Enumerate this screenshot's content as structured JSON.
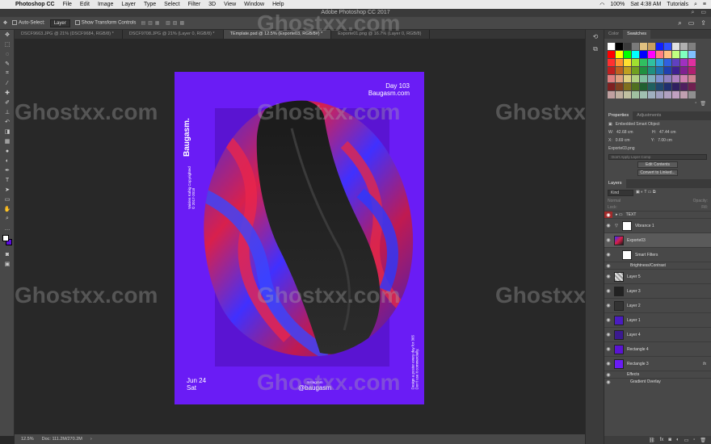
{
  "menubar": {
    "app_name": "Photoshop CC",
    "items": [
      "File",
      "Edit",
      "Image",
      "Layer",
      "Type",
      "Select",
      "Filter",
      "3D",
      "View",
      "Window",
      "Help"
    ],
    "clock": "Sat 4:38 AM",
    "user": "Tutorials",
    "battery": "100%"
  },
  "titlebar": {
    "title": "Adobe Photoshop CC 2017"
  },
  "options": {
    "auto_select_label": "Auto-Select:",
    "auto_select_value": "Layer",
    "transform_label": "Show Transform Controls"
  },
  "tabs": [
    {
      "label": "DSCF9663.JPG @ 21% (DSCF9684, RGB/8) *"
    },
    {
      "label": "DSCF9708.JPG @ 21% (Layer 0, RGB/8) *"
    },
    {
      "label": "TEmplate.psd @ 12.5% (Exporte03, RGB/8#) *"
    },
    {
      "label": "Exporte01.png @ 16.7% (Layer 0, RGB/8)"
    }
  ],
  "poster": {
    "day_line": "Day 103",
    "site_line": "Baugasm.com",
    "vertical_title": "Baugasm.",
    "vertical_copy_1": "Vaislen Kahig Copyrighted",
    "vertical_copy_2": "© 2017-2018",
    "date_line_1": "Jun 24",
    "date_line_2": "Sat",
    "insta_label": "Instagram",
    "insta_handle": "@baugasm",
    "vertical_right_1": "Design a poster every day for 365",
    "vertical_right_2": "Don't use it commercially.",
    "colors": {
      "background": "#6a1cf5",
      "accent_red": "#e02046",
      "accent_blue": "#3a2cff"
    }
  },
  "watermark": "Ghostxx.com",
  "status": {
    "zoom": "12.5%",
    "doc": "Doc: 111.2M/270.2M"
  },
  "panels": {
    "color_tab": "Color",
    "swatches_tab": "Swatches",
    "swatch_colors": [
      "#ffffff",
      "#000000",
      "#3a3a3a",
      "#7a7a7a",
      "#e0c080",
      "#c8a060",
      "#1020ff",
      "#3050ff",
      "#e0e0e0",
      "#b0b0b0",
      "#808080",
      "#ff0000",
      "#ffff00",
      "#00ff00",
      "#00ffff",
      "#0000ff",
      "#ff00ff",
      "#ff8080",
      "#ffc080",
      "#c0ff80",
      "#80ffc0",
      "#80c0ff",
      "#ff3030",
      "#ff9030",
      "#ffe030",
      "#a0e030",
      "#30c060",
      "#30c0a0",
      "#30a0e0",
      "#3060e0",
      "#6040c0",
      "#a030c0",
      "#e030a0",
      "#c02020",
      "#c06020",
      "#c0a020",
      "#70a020",
      "#209040",
      "#209080",
      "#2070b0",
      "#2040b0",
      "#402090",
      "#802090",
      "#b02070",
      "#e08080",
      "#e0a080",
      "#e0d080",
      "#b0d080",
      "#80c0a0",
      "#80b0c0",
      "#8090d0",
      "#9080c0",
      "#b080c0",
      "#d080b0",
      "#d08090",
      "#802020",
      "#804020",
      "#807020",
      "#507020",
      "#206030",
      "#206060",
      "#204870",
      "#203070",
      "#302060",
      "#502060",
      "#702050",
      "#c0a0a0",
      "#c0b0a0",
      "#c0c0a0",
      "#a0c0a0",
      "#a0c0b0",
      "#a0b0c0",
      "#a0a0c0",
      "#b0a0c0",
      "#c0a0c0",
      "#c0a0b0",
      "#909090"
    ],
    "properties_tab": "Properties",
    "adjustments_tab": "Adjustments",
    "smart_object": "Embedded Smart Object",
    "w_label": "W:",
    "w_value": "42.68 cm",
    "h_label": "H:",
    "h_value": "47.44 cm",
    "x_label": "X:",
    "x_value": "0.69 cm",
    "y_label": "Y:",
    "y_value": "7.00 cm",
    "filename": "Exporte03.png",
    "layer_comp": "Don't Apply Layer Comp",
    "edit_contents": "Edit Contents",
    "convert_linked": "Convert to Linked...",
    "layers_tab": "Layers",
    "kind_label": "Kind",
    "normal_label": "Normal",
    "opacity_label": "Opacity:",
    "lock_label": "Lock:",
    "fill_label": "Fill:",
    "layers": [
      {
        "name": "TEXT",
        "type": "folder"
      },
      {
        "name": "Vibrance 1",
        "type": "adjust"
      },
      {
        "name": "Exporte03",
        "type": "smart"
      },
      {
        "name": "Smart Filters",
        "type": "filter"
      },
      {
        "name": "Brightness/Contrast",
        "type": "filterline"
      },
      {
        "name": "Layer 5",
        "type": "pixel"
      },
      {
        "name": "Layer 3",
        "type": "pixel"
      },
      {
        "name": "Layer 2",
        "type": "pixel"
      },
      {
        "name": "Layer 1",
        "type": "pixel"
      },
      {
        "name": "Layer 4",
        "type": "pixel"
      },
      {
        "name": "Rectangle 4",
        "type": "shape"
      },
      {
        "name": "Rectangle 3",
        "type": "shape"
      },
      {
        "name": "Effects",
        "type": "fxline"
      },
      {
        "name": "Gradient Overlay",
        "type": "fxline"
      }
    ],
    "fx_label": "fx"
  }
}
